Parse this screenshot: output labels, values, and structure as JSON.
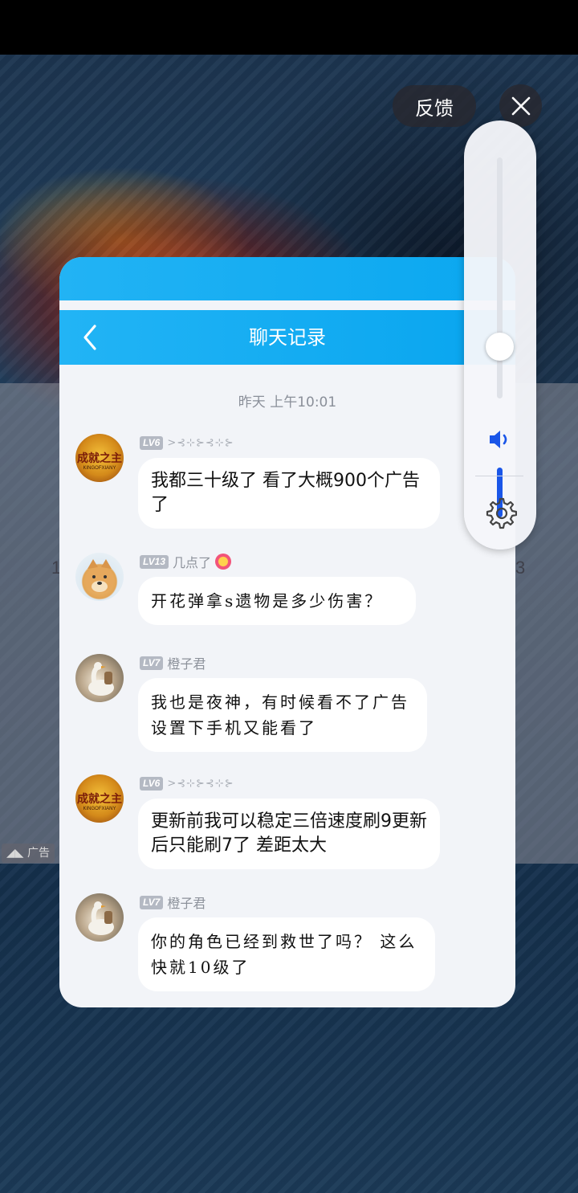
{
  "overlay": {
    "feedback_label": "反馈",
    "ad_label": "广告",
    "side_numbers": [
      "1",
      "3"
    ]
  },
  "chat": {
    "title": "聊天记录",
    "timestamp": "昨天 上午10:01",
    "messages": [
      {
        "level": "LV6",
        "name": ">⊰⊹⊱⊰⊹⊱",
        "avatar_text": "成就之主",
        "avatar_sub": "KINGOFXIANY",
        "text": "我都三十级了 看了大概900个广告了"
      },
      {
        "level": "LV13",
        "name": "几点了",
        "text": "开花弹拿s遗物是多少伤害？"
      },
      {
        "level": "LV7",
        "name": "橙子君",
        "text": "我也是夜神，有时候看不了广告设置下手机又能看了"
      },
      {
        "level": "LV6",
        "name": ">⊰⊹⊱⊰⊹⊱",
        "avatar_text": "成就之主",
        "avatar_sub": "KINGOFXIANY",
        "text": "更新前我可以稳定三倍速度刷9更新后只能刷7了 差距太大"
      },
      {
        "level": "LV7",
        "name": "橙子君",
        "text": "你的角色已经到救世了吗？ 这么快就10级了"
      }
    ]
  },
  "volume": {
    "level_fraction": 0.28,
    "accent": "#1a56e8"
  },
  "colors": {
    "header_blue": "#0aa7f0",
    "bubble_bg": "#ffffff",
    "chat_bg": "#f2f4f8"
  },
  "icons": [
    "close-icon",
    "back-arrow-icon",
    "speaker-icon",
    "settings-gear-icon"
  ]
}
